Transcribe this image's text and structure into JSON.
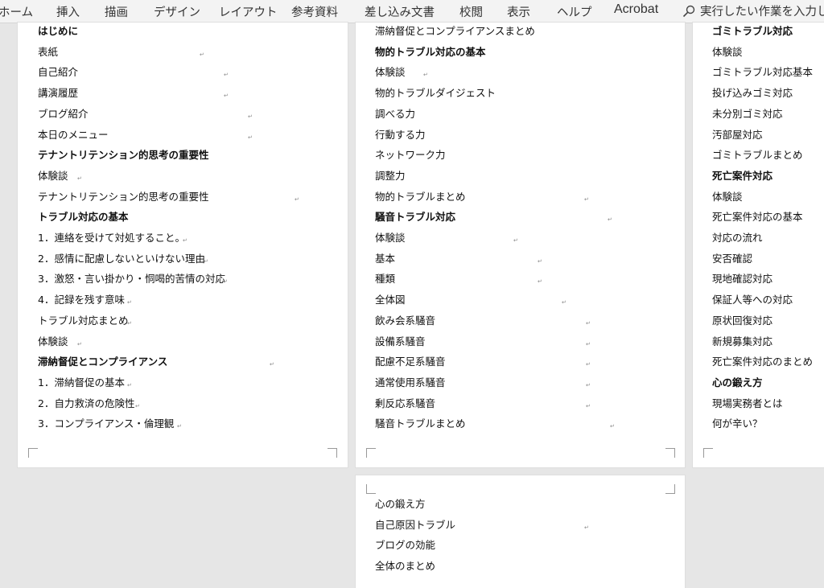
{
  "ribbon": {
    "tabs": [
      "ホーム",
      "挿入",
      "描画",
      "デザイン",
      "レイアウト",
      "参考資料",
      "差し込み文書",
      "校閲",
      "表示",
      "ヘルプ",
      "Acrobat"
    ],
    "search_text": "実行したい作業を入力し"
  },
  "pages": {
    "p1": [
      {
        "text": "はじめに",
        "bold": true
      },
      {
        "text": "表紙",
        "bold": false
      },
      {
        "text": "自己紹介",
        "bold": false
      },
      {
        "text": "講演履歴",
        "bold": false
      },
      {
        "text": "ブログ紹介",
        "bold": false
      },
      {
        "text": "本日のメニュー",
        "bold": false
      },
      {
        "text": "テナントリテンション的思考の重要性",
        "bold": true
      },
      {
        "text": "体験談",
        "bold": false
      },
      {
        "text": "テナントリテンション的思考の重要性",
        "bold": false
      },
      {
        "text": "トラブル対応の基本",
        "bold": true
      },
      {
        "text": "1．連絡を受けて対処すること。",
        "bold": false
      },
      {
        "text": "2．感情に配慮しないといけない理由",
        "bold": false
      },
      {
        "text": "3．激怒・言い掛かり・恫喝的苦情の対応",
        "bold": false
      },
      {
        "text": "4．記録を残す意味",
        "bold": false
      },
      {
        "text": "トラブル対応まとめ",
        "bold": false
      },
      {
        "text": "体験談",
        "bold": false
      },
      {
        "text": "滞納督促とコンプライアンス",
        "bold": true
      },
      {
        "text": "1．滞納督促の基本",
        "bold": false
      },
      {
        "text": "2．自力救済の危険性",
        "bold": false
      },
      {
        "text": "3．コンプライアンス・倫理観",
        "bold": false
      }
    ],
    "p2": [
      {
        "text": "滞納督促とコンプライアンスまとめ",
        "bold": false
      },
      {
        "text": "物的トラブル対応の基本",
        "bold": true
      },
      {
        "text": "体験談",
        "bold": false
      },
      {
        "text": "物的トラブルダイジェスト",
        "bold": false
      },
      {
        "text": "調べる力",
        "bold": false
      },
      {
        "text": "行動する力",
        "bold": false
      },
      {
        "text": "ネットワーク力",
        "bold": false
      },
      {
        "text": "調整力",
        "bold": false
      },
      {
        "text": "物的トラブルまとめ",
        "bold": false
      },
      {
        "text": "騒音トラブル対応",
        "bold": true
      },
      {
        "text": "体験談",
        "bold": false
      },
      {
        "text": "基本",
        "bold": false
      },
      {
        "text": "種類",
        "bold": false
      },
      {
        "text": "全体図",
        "bold": false
      },
      {
        "text": "飲み会系騒音",
        "bold": false
      },
      {
        "text": "設備系騒音",
        "bold": false
      },
      {
        "text": "配慮不足系騒音",
        "bold": false
      },
      {
        "text": "通常使用系騒音",
        "bold": false
      },
      {
        "text": "剰反応系騒音",
        "bold": false
      },
      {
        "text": "騒音トラブルまとめ",
        "bold": false
      }
    ],
    "p3": [
      {
        "text": "ゴミトラブル対応",
        "bold": true
      },
      {
        "text": "体験談",
        "bold": false
      },
      {
        "text": "ゴミトラブル対応基本",
        "bold": false
      },
      {
        "text": "投げ込みゴミ対応",
        "bold": false
      },
      {
        "text": "未分別ゴミ対応",
        "bold": false
      },
      {
        "text": "汚部屋対応",
        "bold": false
      },
      {
        "text": "ゴミトラブルまとめ",
        "bold": false
      },
      {
        "text": "死亡案件対応",
        "bold": true
      },
      {
        "text": "体験談",
        "bold": false
      },
      {
        "text": "死亡案件対応の基本",
        "bold": false
      },
      {
        "text": "対応の流れ",
        "bold": false
      },
      {
        "text": "安否確認",
        "bold": false
      },
      {
        "text": "現地確認対応",
        "bold": false
      },
      {
        "text": "保証人等への対応",
        "bold": false
      },
      {
        "text": "原状回復対応",
        "bold": false
      },
      {
        "text": "新規募集対応",
        "bold": false
      },
      {
        "text": "死亡案件対応のまとめ",
        "bold": false
      },
      {
        "text": "心の鍛え方",
        "bold": true
      },
      {
        "text": "現場実務者とは",
        "bold": false
      },
      {
        "text": "何が辛い？",
        "bold": false
      }
    ],
    "p4": [
      {
        "text": "心の鍛え方",
        "bold": false
      },
      {
        "text": "自己原因トラブル",
        "bold": false
      },
      {
        "text": "ブログの効能",
        "bold": false
      },
      {
        "text": "全体のまとめ",
        "bold": false
      }
    ]
  },
  "paragraph_mark": "↵"
}
